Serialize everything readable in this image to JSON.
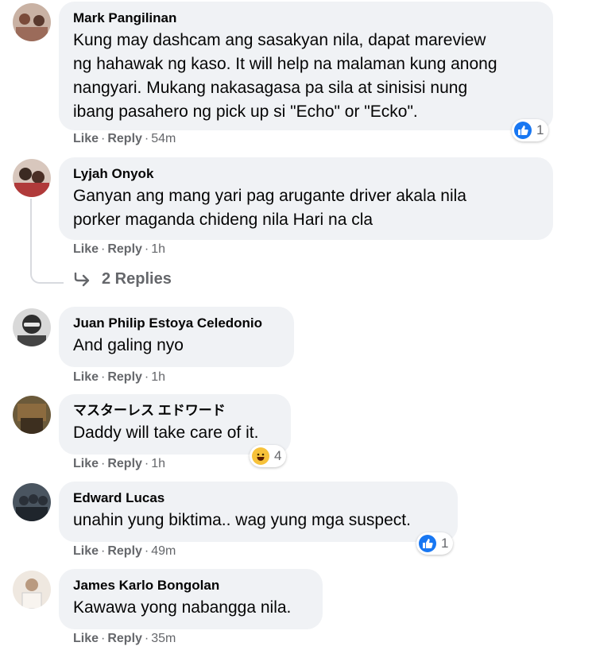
{
  "comments": [
    {
      "author": "Mark Pangilinan",
      "lines": [
        "Kung may dashcam ang sasakyan nila, dapat mareview",
        "ng hahawak ng kaso. It will help na malaman kung anong",
        "nangyari. Mukang nakasagasa pa sila at sinisisi nung",
        "ibang pasahero ng pick up si \"Echo\" or \"Ecko\"."
      ],
      "like": "Like",
      "reply": "Reply",
      "time": "54m",
      "reaction": {
        "icon": "like-icon",
        "count": "1"
      }
    },
    {
      "author": "Lyjah Onyok",
      "lines": [
        "Ganyan ang mang yari pag arugante driver akala nila",
        "porker maganda chideng nila Hari na cla"
      ],
      "like": "Like",
      "reply": "Reply",
      "time": "1h",
      "replies": "2 Replies"
    },
    {
      "author": "Juan Philip Estoya Celedonio",
      "lines": [
        "And galing nyo"
      ],
      "like": "Like",
      "reply": "Reply",
      "time": "1h"
    },
    {
      "author": "マスターレス エドワード",
      "lines": [
        "Daddy will take care of it."
      ],
      "like": "Like",
      "reply": "Reply",
      "time": "1h",
      "reaction": {
        "icon": "haha-icon",
        "count": "4"
      }
    },
    {
      "author": "Edward Lucas",
      "lines": [
        "unahin yung biktima.. wag yung mga suspect."
      ],
      "like": "Like",
      "reply": "Reply",
      "time": "49m",
      "reaction": {
        "icon": "like-icon",
        "count": "1"
      }
    },
    {
      "author": "James Karlo Bongolan",
      "lines": [
        "Kawawa yong nabangga nila."
      ],
      "like": "Like",
      "reply": "Reply",
      "time": "35m"
    }
  ],
  "colors": {
    "bubble": "#f0f2f5",
    "meta": "#65676b",
    "like_blue": "#1877f2",
    "haha_yellow": "#f7c23a"
  }
}
